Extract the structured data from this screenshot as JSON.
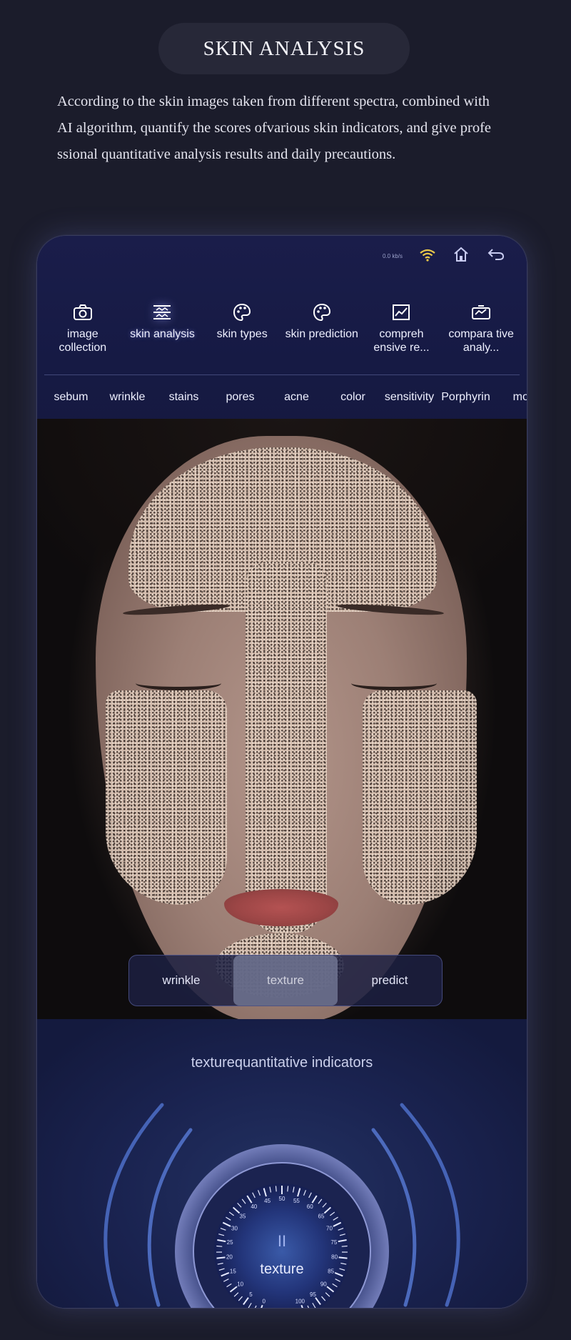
{
  "header": {
    "title": "SKIN ANALYSIS",
    "description": "According to the skin images taken from different spectra, combined with AI algorithm, quantify the scores ofvarious skin indicators, and give professional quantitative analysis results and daily precautions."
  },
  "status_bar": {
    "speed": "0.0 kb/s",
    "icons": [
      "wifi-icon",
      "home-icon",
      "back-icon"
    ]
  },
  "tabs": [
    {
      "label": "image collection",
      "icon": "camera-icon"
    },
    {
      "label": "skin analysis",
      "icon": "analysis-icon"
    },
    {
      "label": "skin types",
      "icon": "palette-icon"
    },
    {
      "label": "skin prediction",
      "icon": "palette-icon"
    },
    {
      "label": "compreh ensive re...",
      "icon": "chart-icon"
    },
    {
      "label": "compara tive analy...",
      "icon": "compare-icon"
    }
  ],
  "sub_tabs": [
    "sebum",
    "wrinkle",
    "stains",
    "pores",
    "acne",
    "color",
    "sensitivity",
    "Porphyrin",
    "moi"
  ],
  "segment": {
    "items": [
      "wrinkle",
      "texture",
      "predict"
    ],
    "active": "texture"
  },
  "indicator": {
    "title": "texturequantitative indicators",
    "dial_label": "texture",
    "pause_symbol": "II",
    "scale_ticks": [
      "0",
      "5",
      "10",
      "15",
      "20",
      "25",
      "30",
      "35",
      "40",
      "45",
      "50",
      "55",
      "60",
      "65",
      "70",
      "75",
      "80",
      "85",
      "90",
      "95",
      "100"
    ],
    "accent_color": "#6f8ee0"
  }
}
